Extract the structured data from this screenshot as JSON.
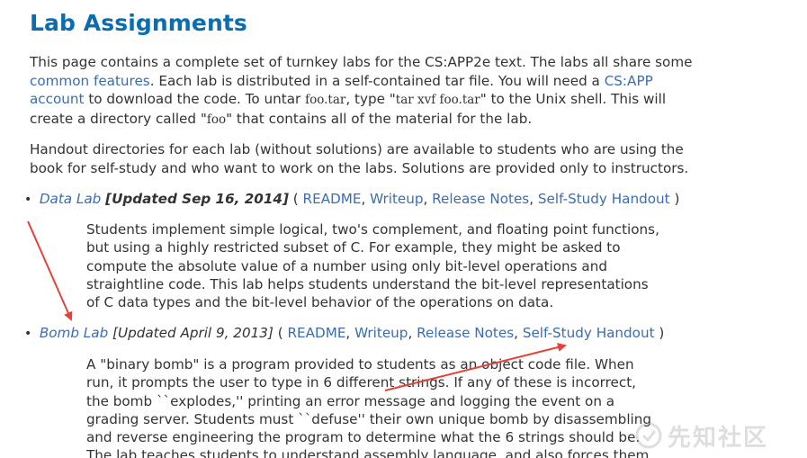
{
  "page": {
    "title": "Lab Assignments"
  },
  "intro": {
    "p1_a": "This page contains a complete set of turnkey labs for the CS:APP2e text. The labs all share some",
    "p1_link_common": "common features",
    "p1_b": ". Each lab is distributed in a self-contained tar file. You will need a ",
    "p1_link_account_1": "CS:APP",
    "p1_link_account_2": "account",
    "p1_c": " to download the code. To untar ",
    "p1_code1": "foo.tar",
    "p1_d": ", type \"",
    "p1_code2": "tar xvf foo.tar",
    "p1_e": "\" to the Unix shell. This will",
    "p1_f": "create a directory called \"",
    "p1_code3": "foo",
    "p1_g": "\" that contains all of the material for the lab.",
    "p2_line1": "Handout directories for each lab (without solutions) are available to students who are using the",
    "p2_line2": "book for self-study and who want to work on the labs. Solutions are provided only to instructors."
  },
  "labs": [
    {
      "name": "Data Lab",
      "updated": "[Updated Sep 16, 2014]",
      "links": {
        "readme": "README",
        "writeup": "Writeup",
        "release_notes": "Release Notes",
        "handout": "Self-Study Handout"
      },
      "description": [
        "Students implement simple logical, two's complement, and floating point functions,",
        "but using a highly restricted subset of C. For example, they might be asked to",
        "compute the absolute value of a number using only bit-level operations and",
        "straightline code. This lab helps students understand the bit-level representations",
        "of C data types and the bit-level behavior of the operations on data."
      ]
    },
    {
      "name": "Bomb Lab",
      "updated": "[Updated April 9, 2013]",
      "links": {
        "readme": "README",
        "writeup": "Writeup",
        "release_notes": "Release Notes",
        "handout": "Self-Study Handout"
      },
      "description": [
        "A \"binary bomb\" is a program provided to students as an object code file. When",
        "run, it prompts the user to type in 6 different strings. If any of these is incorrect,",
        "the bomb ``explodes,'' printing an error message and logging the event on a",
        "grading server. Students must ``defuse'' their own unique bomb by disassembling",
        "and reverse engineering the program to determine what the 6 strings should be.",
        "The lab teaches students to understand assembly language, and also forces them"
      ]
    }
  ],
  "punct": {
    "open": "( ",
    "close": " )",
    "sep": ", ",
    "space": " "
  },
  "watermark": {
    "text": "先知社区"
  },
  "colors": {
    "heading": "#0b6cb0",
    "link": "#3a6cb4",
    "body_text": "#333333",
    "annotation_arrow": "#e8413a"
  }
}
